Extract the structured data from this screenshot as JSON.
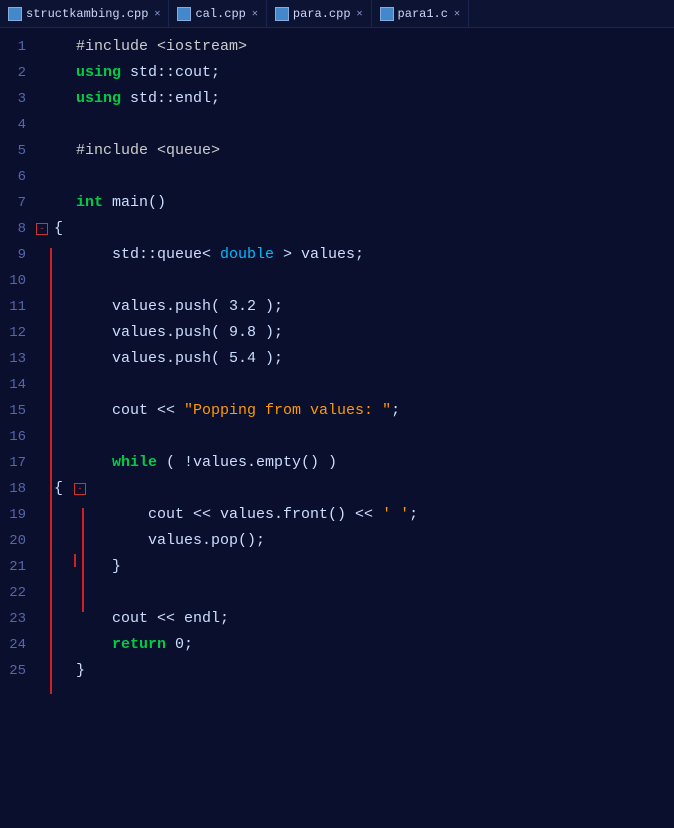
{
  "tabs": [
    {
      "label": "structkambing.cpp",
      "active": false
    },
    {
      "label": "cal.cpp",
      "active": false
    },
    {
      "label": "para.cpp",
      "active": true
    },
    {
      "label": "para1.c",
      "active": false
    }
  ],
  "lines": [
    {
      "num": 1,
      "tokens": [
        {
          "t": "preprocessor",
          "v": "    #include <iostream>"
        }
      ]
    },
    {
      "num": 2,
      "tokens": [
        {
          "t": "indent",
          "v": "    "
        },
        {
          "t": "kw-using",
          "v": "using"
        },
        {
          "t": "normal",
          "v": " std::cout;"
        }
      ]
    },
    {
      "num": 3,
      "tokens": [
        {
          "t": "indent",
          "v": "    "
        },
        {
          "t": "kw-using",
          "v": "using"
        },
        {
          "t": "normal",
          "v": " std::endl;"
        }
      ]
    },
    {
      "num": 4,
      "tokens": []
    },
    {
      "num": 5,
      "tokens": [
        {
          "t": "preprocessor",
          "v": "    #include <queue>"
        }
      ]
    },
    {
      "num": 6,
      "tokens": []
    },
    {
      "num": 7,
      "tokens": [
        {
          "t": "indent",
          "v": "    "
        },
        {
          "t": "kw-int",
          "v": "int"
        },
        {
          "t": "normal",
          "v": " main()"
        }
      ]
    },
    {
      "num": 8,
      "fold": "-",
      "tokens": [
        {
          "t": "normal",
          "v": "    {"
        }
      ]
    },
    {
      "num": 9,
      "tokens": [
        {
          "t": "normal",
          "v": "        std::queue< "
        },
        {
          "t": "kw-double",
          "v": "double"
        },
        {
          "t": "normal",
          "v": " > values;"
        }
      ]
    },
    {
      "num": 10,
      "tokens": []
    },
    {
      "num": 11,
      "tokens": [
        {
          "t": "normal",
          "v": "        values.push( 3.2 );"
        }
      ]
    },
    {
      "num": 12,
      "tokens": [
        {
          "t": "normal",
          "v": "        values.push( 9.8 );"
        }
      ]
    },
    {
      "num": 13,
      "tokens": [
        {
          "t": "normal",
          "v": "        values.push( 5.4 );"
        }
      ]
    },
    {
      "num": 14,
      "tokens": []
    },
    {
      "num": 15,
      "tokens": [
        {
          "t": "normal",
          "v": "        cout << "
        },
        {
          "t": "string",
          "v": "\"Popping from values: \""
        },
        {
          "t": "normal",
          "v": ";"
        }
      ]
    },
    {
      "num": 16,
      "tokens": []
    },
    {
      "num": 17,
      "tokens": [
        {
          "t": "indent",
          "v": "        "
        },
        {
          "t": "kw-while",
          "v": "while"
        },
        {
          "t": "normal",
          "v": " ( !values.empty() )"
        }
      ]
    },
    {
      "num": 18,
      "fold": "-",
      "tokens": [
        {
          "t": "normal",
          "v": "    {"
        }
      ]
    },
    {
      "num": 19,
      "tokens": [
        {
          "t": "normal",
          "v": "            cout << values.front() << "
        },
        {
          "t": "char-literal",
          "v": "' '"
        },
        {
          "t": "normal",
          "v": ";"
        }
      ]
    },
    {
      "num": 20,
      "tokens": [
        {
          "t": "normal",
          "v": "            values.pop();"
        }
      ]
    },
    {
      "num": 21,
      "fold": "dash",
      "tokens": [
        {
          "t": "normal",
          "v": "        }"
        }
      ]
    },
    {
      "num": 22,
      "tokens": []
    },
    {
      "num": 23,
      "tokens": [
        {
          "t": "normal",
          "v": "        cout << endl;"
        }
      ]
    },
    {
      "num": 24,
      "tokens": [
        {
          "t": "indent",
          "v": "        "
        },
        {
          "t": "kw-return",
          "v": "return"
        },
        {
          "t": "normal",
          "v": " 0;"
        }
      ]
    },
    {
      "num": 25,
      "tokens": [
        {
          "t": "normal",
          "v": "    }"
        }
      ]
    }
  ]
}
